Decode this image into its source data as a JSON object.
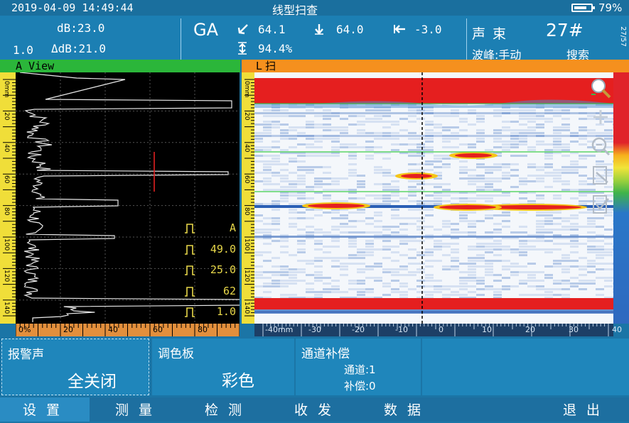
{
  "status": {
    "datetime": "2019-04-09 14:49:44",
    "title": "线型扫查",
    "battery_percent": "79%",
    "battery_level": 0.79
  },
  "info": {
    "db": "dB:23.0",
    "db_step": "1.0",
    "delta_db": "ΔdB:21.0",
    "gate_mode": "GA",
    "sound_path": "64.1",
    "depth": "64.0",
    "surface_distance": "-3.0",
    "amplitude": "94.4%",
    "beam_label": "声 束",
    "beam_number": "27#",
    "peak_mode": "波峰:手动",
    "search_label": "搜索",
    "page_indicator": "27/57"
  },
  "aview": {
    "title": "A View",
    "depth_ticks": [
      "0mm",
      "20",
      "40",
      "60",
      "80",
      "100",
      "120",
      "140"
    ],
    "amp_ticks": [
      "0%",
      "20",
      "40",
      "60",
      "80"
    ],
    "params": [
      {
        "icon": "pulse-icon",
        "value": "A"
      },
      {
        "icon": "gate-start-icon",
        "value": "49.0"
      },
      {
        "icon": "gate-width-icon",
        "value": "25.0"
      },
      {
        "icon": "gate-height-icon",
        "value": "62"
      },
      {
        "icon": "step-icon",
        "value": "1.0"
      }
    ]
  },
  "lscan": {
    "title": "L 扫",
    "depth_ticks": [
      "0mm",
      "20",
      "40",
      "60",
      "80",
      "100",
      "120",
      "140"
    ],
    "pos_ticks": [
      "-40mm",
      "-30",
      "-20",
      "-10",
      "0",
      "10",
      "20",
      "30",
      "40"
    ]
  },
  "tools": [
    "zoom-icon",
    "add-icon",
    "zoom-out-icon",
    "edit-doc-icon",
    "check-doc-icon"
  ],
  "panels": {
    "alarm": {
      "label": "报警声",
      "value": "全关闭"
    },
    "palette": {
      "label": "调色板",
      "value": "彩色"
    },
    "channel": {
      "label": "通道补偿",
      "channel": "通道:1",
      "compensation": "补偿:0"
    }
  },
  "menu": [
    "设置",
    "测量",
    "检测",
    "收发",
    "数据",
    "退出"
  ]
}
